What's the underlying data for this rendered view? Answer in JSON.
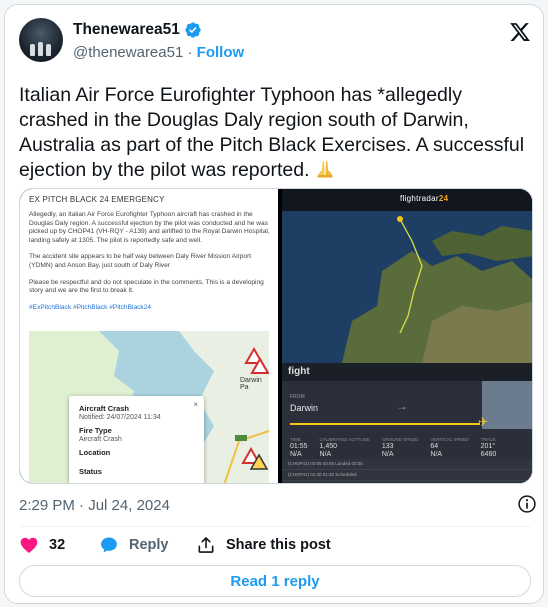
{
  "author": {
    "name": "Thenewarea51",
    "handle": "@thenewarea51",
    "separator": "·",
    "follow_label": "Follow"
  },
  "tweet": {
    "text": "Italian Air Force Eurofighter Typhoon  has *allegedly crashed in the Douglas Daly region south of Darwin, Australia as part of the Pitch Black Exercises. A successful ejection by the pilot was reported.",
    "emoji": "folded-hands-icon"
  },
  "media": {
    "post": {
      "title": "EX PITCH BLACK 24 EMERGENCY",
      "paragraph1": "Allegedly, an Italian Air Force Eurofighter Typhoon aircraft has crashed in the Douglas Daly region. A successful ejection by the pilot was conducted and he was picked up by CHOP41 (VH-RQY - A139) and airlifted to the Royal Darwin Hospital, landing safely at 1305. The pilot is reportedly safe and well.",
      "paragraph2": "The accident site appears to be half way between Daly River Mission Airport (YDMN) and Anson Bay, just south of Daly River",
      "paragraph3": "Please be respectful and do not speculate in the comments. This is a developing story and we are the first to break it.",
      "tags": "#ExPitchBlack #PitchBlack #PitchBlack24"
    },
    "map_popup": {
      "title": "Aircraft Crash",
      "notified": "Notified: 24/07/2024 11:34",
      "fire_type_label": "Fire Type",
      "fire_type_value": "Aircraft Crash",
      "location_label": "Location",
      "status_label": "Status",
      "map_label": "Darwin Pa"
    },
    "flightradar": {
      "logo_main": "flightradar",
      "logo_num": "24",
      "header": "fight",
      "origin_label": "FROM",
      "origin": "Darwin",
      "stats": [
        {
          "k": "TIME",
          "v": "01:55"
        },
        {
          "k": "CALIBRATED ALTITUDE",
          "v": "1,450"
        },
        {
          "k": "GROUND SPEED",
          "v": "133"
        },
        {
          "k": "VERTICAL SPEED",
          "v": "64"
        },
        {
          "k": "TRACK",
          "v": "201°"
        }
      ],
      "stats2": [
        {
          "v": "N/A"
        },
        {
          "v": "N/A"
        },
        {
          "v": "N/A"
        },
        {
          "v": "N/A"
        },
        {
          "v": "6460"
        }
      ],
      "row1": "(CHOP41)   03:05   03:05   Landed 03:05",
      "row2": "(CHOP41)   01:40   01:40   Scheduled"
    }
  },
  "meta": {
    "time": "2:29 PM",
    "date": "Jul 24, 2024",
    "sep": " · "
  },
  "actions": {
    "like_count": "32",
    "reply_label": "Reply",
    "share_label": "Share this post"
  },
  "read_replies_label": "Read 1 reply",
  "colors": {
    "accent": "#1d9bf0",
    "like": "#f91880",
    "text": "#0f1419",
    "muted": "#536471"
  }
}
